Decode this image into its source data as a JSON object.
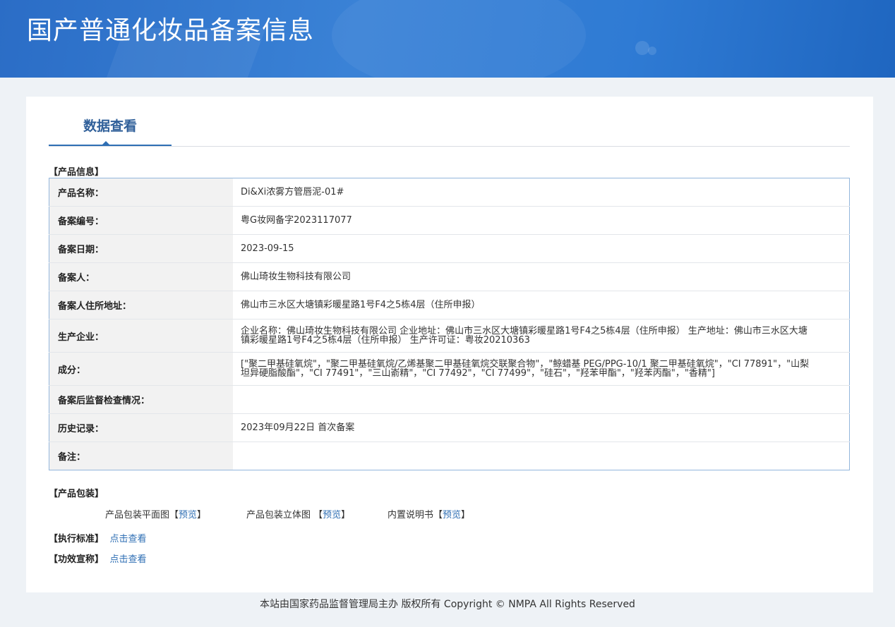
{
  "header": {
    "title": "国产普通化妆品备案信息"
  },
  "tabs": {
    "active": "数据查看"
  },
  "product_info": {
    "section_title": "【产品信息】",
    "rows": [
      {
        "label": "产品名称：",
        "value": "Di&Xi浓雾方管唇泥-01#"
      },
      {
        "label": "备案编号：",
        "value": "粤G妆网备字2023117077"
      },
      {
        "label": "备案日期：",
        "value": "2023-09-15"
      },
      {
        "label": "备案人：",
        "value": "佛山琦妆生物科技有限公司"
      },
      {
        "label": "备案人住所地址：",
        "value": "佛山市三水区大塘镇彩暖星路1号F4之5栋4层（住所申报）"
      },
      {
        "label": "生产企业：",
        "value": "企业名称：佛山琦妆生物科技有限公司 企业地址：佛山市三水区大塘镇彩暖星路1号F4之5栋4层（住所申报） 生产地址：佛山市三水区大塘镇彩暖星路1号F4之5栋4层（住所申报） 生产许可证：粤妆20210363"
      },
      {
        "label": "成分：",
        "value": "[\"聚二甲基硅氧烷\"，\"聚二甲基硅氧烷/乙烯基聚二甲基硅氧烷交联聚合物\"，\"鲸蜡基 PEG/PPG-10/1 聚二甲基硅氧烷\"，\"CI 77891\"，\"山梨坦异硬脂酸酯\"，\"CI 77491\"，\"三山嵛精\"，\"CI 77492\"，\"CI 77499\"，\"硅石\"，\"羟苯甲酯\"，\"羟苯丙酯\"，\"香精\"]"
      },
      {
        "label": "备案后监督检查情况：",
        "value": ""
      },
      {
        "label": "历史记录：",
        "value": "2023年09月22日 首次备案"
      },
      {
        "label": "备注：",
        "value": ""
      }
    ]
  },
  "packaging": {
    "section_title": "【产品包装】",
    "items": [
      {
        "label": "产品包装平面图",
        "link": "预览"
      },
      {
        "label": "产品包装立体图 ",
        "link": "预览"
      },
      {
        "label": "内置说明书",
        "link": "预览"
      }
    ],
    "bracket_open": "【",
    "bracket_close": "】"
  },
  "standard": {
    "section_title": "【执行标准】",
    "link": "点击查看"
  },
  "efficacy": {
    "section_title": "【功效宣称】",
    "link": "点击查看"
  },
  "footer": {
    "text": "本站由国家药品监督管理局主办 版权所有 Copyright © NMPA All Rights Reserved"
  }
}
